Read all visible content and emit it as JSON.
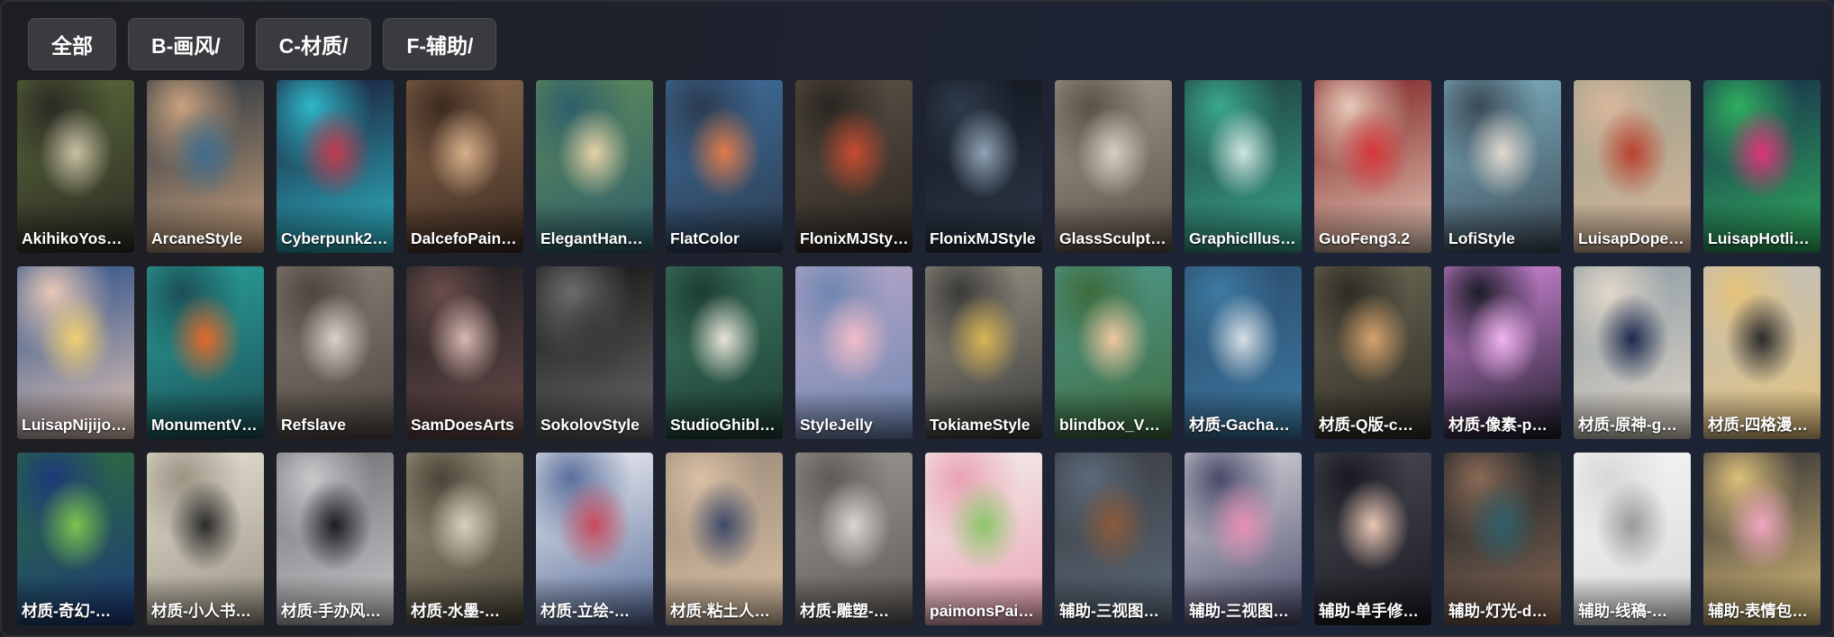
{
  "tabs": [
    {
      "label": "全部"
    },
    {
      "label": "B-画风/"
    },
    {
      "label": "C-材质/"
    },
    {
      "label": "F-辅助/"
    }
  ],
  "cards": [
    {
      "label": "AkihikoYosh…",
      "palette": [
        "#5a6a3a",
        "#c9c0a5",
        "#2b2a24"
      ]
    },
    {
      "label": "ArcaneStyle",
      "palette": [
        "#24303d",
        "#3f6d8e",
        "#c9a27e"
      ]
    },
    {
      "label": "Cyberpunk2…",
      "palette": [
        "#1a1430",
        "#c23a4e",
        "#2fb7c7"
      ]
    },
    {
      "label": "DalcefoPain…",
      "palette": [
        "#8b6a4e",
        "#d8b08a",
        "#3d2b21"
      ]
    },
    {
      "label": "ElegantHan…",
      "palette": [
        "#5f8a5a",
        "#e5d2a8",
        "#2e5f6b"
      ]
    },
    {
      "label": "FlatColor",
      "palette": [
        "#3f6f9c",
        "#e07b4c",
        "#2c3b4f"
      ]
    },
    {
      "label": "FlonixMJSty…",
      "palette": [
        "#5d5347",
        "#c84b2f",
        "#2a2521"
      ]
    },
    {
      "label": "FlonixMJStyle",
      "palette": [
        "#11151d",
        "#8fa3b5",
        "#2e3a4a"
      ]
    },
    {
      "label": "GlassSculpt…",
      "palette": [
        "#a39a8f",
        "#d8cfc3",
        "#5b5147"
      ]
    },
    {
      "label": "GraphicIllus…",
      "palette": [
        "#1e3a3c",
        "#cfe6e2",
        "#3aa88d"
      ]
    },
    {
      "label": "GuoFeng3.2",
      "palette": [
        "#7a1f22",
        "#d5373a",
        "#e7c9b8"
      ]
    },
    {
      "label": "LofiStyle",
      "palette": [
        "#7fb3c2",
        "#e2d9cf",
        "#3d4a57"
      ]
    },
    {
      "label": "LuisapDope…",
      "palette": [
        "#9aa08c",
        "#b9412f",
        "#d9b79b"
      ]
    },
    {
      "label": "LuisapHotli…",
      "palette": [
        "#18284a",
        "#e0337a",
        "#2fb05f"
      ]
    },
    {
      "label": "LuisapNijijo…",
      "palette": [
        "#244a86",
        "#f0cf73",
        "#e8c9b6"
      ]
    },
    {
      "label": "MonumentV…",
      "palette": [
        "#2aa39a",
        "#e4692b",
        "#1c4f57"
      ]
    },
    {
      "label": "Refslave",
      "palette": [
        "#8a8078",
        "#d8d1ca",
        "#4d4640"
      ]
    },
    {
      "label": "SamDoesArts",
      "palette": [
        "#1b1b1f",
        "#d8b7b0",
        "#6a4d4a"
      ]
    },
    {
      "label": "SokolovStyle",
      "palette": [
        "#121212",
        "#3a3a3a",
        "#6b6b6b"
      ]
    },
    {
      "label": "StudioGhibl…",
      "palette": [
        "#3f7a62",
        "#e8e4d8",
        "#1d3d33"
      ]
    },
    {
      "label": "StyleJelly",
      "palette": [
        "#b9a7c8",
        "#f1bcc8",
        "#6f87b1"
      ]
    },
    {
      "label": "TokiameStyle",
      "palette": [
        "#9a9587",
        "#d8b453",
        "#3a3a38"
      ]
    },
    {
      "label": "blindbox_V1…",
      "palette": [
        "#4f9a8f",
        "#f0c8a0",
        "#3e6b3c"
      ]
    },
    {
      "label": "材质-Gacha…",
      "palette": [
        "#2b4a6a",
        "#d6dfe6",
        "#3d7aa2"
      ]
    },
    {
      "label": "材质-Q版-c…",
      "palette": [
        "#6d6a55",
        "#d7a26c",
        "#2e2b24"
      ]
    },
    {
      "label": "材质-像素-p…",
      "palette": [
        "#d88be0",
        "#f1b3ef",
        "#1c1c28"
      ]
    },
    {
      "label": "材质-原神-g…",
      "palette": [
        "#8a9aa3",
        "#1b2a4e",
        "#e2d6c8"
      ]
    },
    {
      "label": "材质-四格漫…",
      "palette": [
        "#bfbfbf",
        "#2a2a2a",
        "#e4c27a"
      ]
    },
    {
      "label": "材质-奇幻-…",
      "palette": [
        "#2f6e3c",
        "#7ec250",
        "#1c3a7a"
      ]
    },
    {
      "label": "材质-小人书…",
      "palette": [
        "#e8e2d4",
        "#2a2a2a",
        "#9a9384"
      ]
    },
    {
      "label": "材质-手办风…",
      "palette": [
        "#6e6e72",
        "#1d1d21",
        "#c9c9cc"
      ]
    },
    {
      "label": "材质-水墨-…",
      "palette": [
        "#a59c86",
        "#d8d0bd",
        "#4a4538"
      ]
    },
    {
      "label": "材质-立绘-…",
      "palette": [
        "#f2f2f4",
        "#c84a5c",
        "#5a6f9c"
      ]
    },
    {
      "label": "材质-粘土人…",
      "palette": [
        "#9a8a7a",
        "#3e4a6a",
        "#d9c0a4"
      ]
    },
    {
      "label": "材质-雕塑-…",
      "palette": [
        "#9c9894",
        "#d9d5d0",
        "#5e5a56"
      ]
    },
    {
      "label": "paimonsPai…",
      "palette": [
        "#f4f1ee",
        "#8dc66a",
        "#e9a2b3"
      ]
    },
    {
      "label": "辅助-三视图…",
      "palette": [
        "#3a3a3e",
        "#8b5a3a",
        "#5a6a7a"
      ]
    },
    {
      "label": "辅助-三视图…",
      "palette": [
        "#d9d9dd",
        "#e790b5",
        "#4a4a6a"
      ]
    },
    {
      "label": "辅助-单手修…",
      "palette": [
        "#4a4a52",
        "#e9c7b3",
        "#1a1a22"
      ]
    },
    {
      "label": "辅助-灯光-d…",
      "palette": [
        "#0f1a22",
        "#2f5f6a",
        "#8a6a55"
      ]
    },
    {
      "label": "辅助-线稿-…",
      "palette": [
        "#f6f6f6",
        "#9a9a9a",
        "#d8d8d8"
      ]
    },
    {
      "label": "辅助-表情包…",
      "palette": [
        "#2a2a32",
        "#f0a6c0",
        "#dcc07a"
      ]
    }
  ]
}
